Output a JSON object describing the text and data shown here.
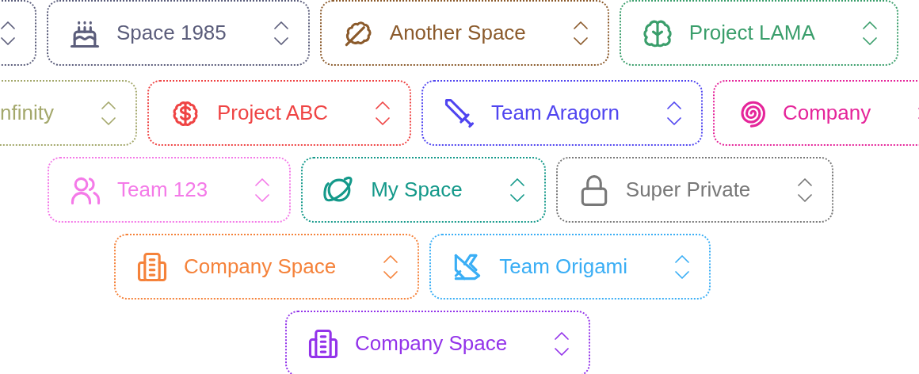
{
  "rows": [
    {
      "cards": [
        {
          "color": "#5b5d7b"
        },
        {
          "label": "Space 1985",
          "kind": "cake",
          "color": "#5b5d7b"
        },
        {
          "label": "Another Space",
          "kind": "leaf",
          "color": "#8b5a2b"
        },
        {
          "label": "Project LAMA",
          "kind": "brain",
          "color": "#3a9e6b"
        }
      ]
    },
    {
      "cards": [
        {
          "label": "nfinity",
          "color": "#a4a86c"
        },
        {
          "label": "Project ABC",
          "kind": "dollar",
          "color": "#ef4444"
        },
        {
          "label": "Team Aragorn",
          "kind": "sword",
          "color": "#5045f0"
        },
        {
          "label": "Company",
          "kind": "spiral",
          "color": "#e5259a"
        }
      ]
    },
    {
      "cards": [
        {
          "label": "Team 123",
          "kind": "users",
          "color": "#f47ae8"
        },
        {
          "label": "My Space",
          "kind": "planet",
          "color": "#14998a"
        },
        {
          "label": "Super Private",
          "kind": "lock",
          "color": "#787878"
        }
      ]
    },
    {
      "cards": [
        {
          "label": "Company Space",
          "kind": "building",
          "color": "#f5823a"
        },
        {
          "label": "Team Origami",
          "kind": "origami",
          "color": "#3aaef5"
        }
      ]
    },
    {
      "cards": [
        {
          "label": "Company Space",
          "kind": "building",
          "color": "#9333ea"
        }
      ]
    }
  ]
}
